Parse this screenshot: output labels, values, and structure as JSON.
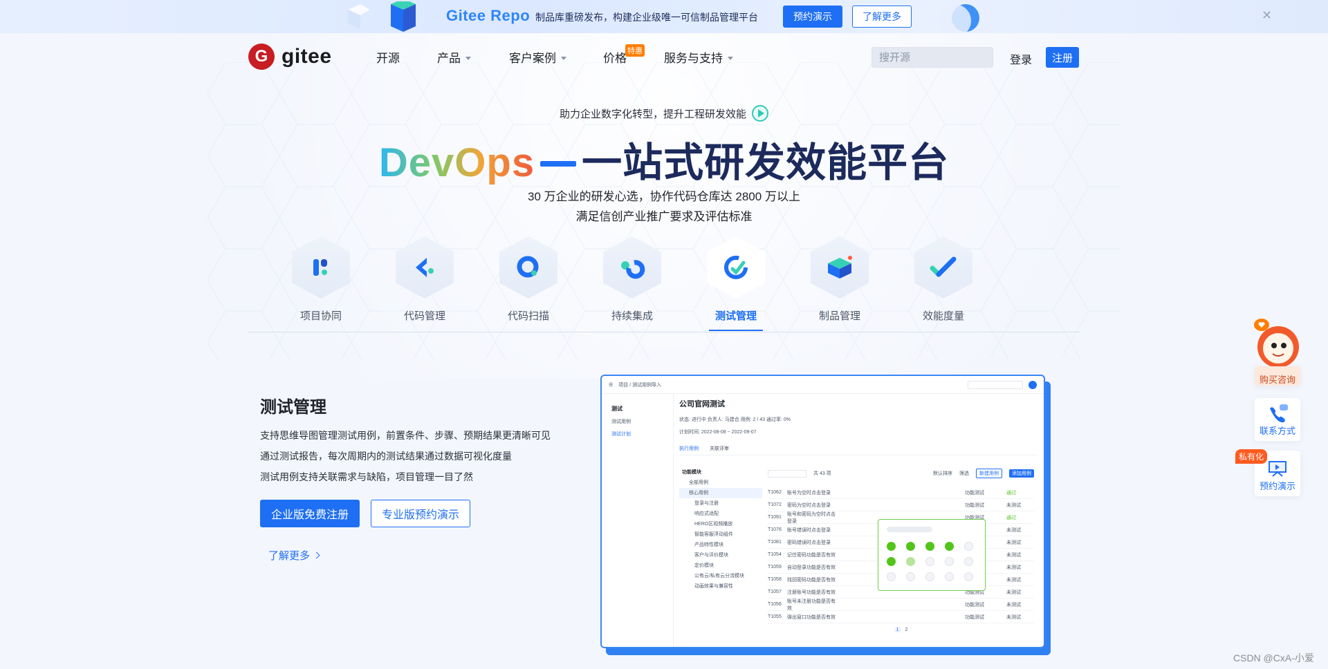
{
  "banner": {
    "brand": "Gitee Repo",
    "description": "制品库重磅发布，构建企业级唯一可信制品管理平台",
    "primary_button": "预约演示",
    "secondary_button": "了解更多",
    "close_icon": "close-icon"
  },
  "nav": {
    "logo_text": "gitee",
    "logo_mark": "G",
    "items": [
      {
        "label": "开源",
        "has_dropdown": false
      },
      {
        "label": "产品",
        "has_dropdown": true
      },
      {
        "label": "客户案例",
        "has_dropdown": true
      },
      {
        "label": "价格",
        "has_dropdown": false,
        "badge": "特惠"
      },
      {
        "label": "服务与支持",
        "has_dropdown": true
      }
    ],
    "search_placeholder": "搜开源",
    "login": "登录",
    "register": "注册"
  },
  "hero": {
    "tagline": "助力企业数字化转型，提升工程研发效能",
    "title_gradient": "DevOps",
    "title_rest": "一站式研发效能平台",
    "subtitle_1": "30 万企业的研发心选，协作代码仓库达 2800 万以上",
    "subtitle_2": "满足信创产业推广要求及评估标准"
  },
  "products": {
    "active_index": 4,
    "items": [
      {
        "label": "项目协同",
        "icon": "project-icon"
      },
      {
        "label": "代码管理",
        "icon": "code-icon"
      },
      {
        "label": "代码扫描",
        "icon": "scan-icon"
      },
      {
        "label": "持续集成",
        "icon": "ci-icon"
      },
      {
        "label": "测试管理",
        "icon": "test-icon"
      },
      {
        "label": "制品管理",
        "icon": "artifact-icon"
      },
      {
        "label": "效能度量",
        "icon": "metrics-icon"
      }
    ]
  },
  "section": {
    "title": "测试管理",
    "features": [
      "支持思维导图管理测试用例，前置条件、步骤、预期结果更清晰可见",
      "通过测试报告，每次周期内的测试结果通过数据可视化度量",
      "测试用例支持关联需求与缺陷，项目管理一目了然"
    ],
    "btn_free": "企业版免费注册",
    "btn_demo": "专业版预约演示",
    "learn_more": "了解更多"
  },
  "screenshot": {
    "breadcrumb": "项目 / 测试用例导入",
    "side_title": "测试",
    "side_items": [
      "测试用例",
      "测试计划"
    ],
    "plan_title": "公司官网测试",
    "meta": "状态: 进行中   负责人: 马建合   用例: 2 / 43   通过率: 0%",
    "dates": "计划时间:   2022-08-08  ~  2022-09-07",
    "tabs": [
      "执行用例",
      "关联评审"
    ],
    "tree_title": "功能模块",
    "tree_items": [
      "全部用例",
      "核心用例",
      "登录与注册",
      "响应式适配",
      "HERO区视频播放",
      "智能客服浮动组件",
      "产品特性模块",
      "客户与评价模块",
      "定价模块",
      "公有云/私有云分流模块",
      "动画效果与兼容性"
    ],
    "table_rows": [
      {
        "id": "T1062",
        "name": "账号为空时点击登录",
        "type": "功能测试",
        "result": "通过"
      },
      {
        "id": "T1072",
        "name": "密码为空时点击登录",
        "type": "功能测试",
        "result": "未测试"
      },
      {
        "id": "T1091",
        "name": "账号和密码为空时点击登录",
        "type": "功能测试",
        "result": "通过"
      },
      {
        "id": "T1076",
        "name": "账号错误时点击登录",
        "type": "功能测试",
        "result": "未测试"
      },
      {
        "id": "T1081",
        "name": "密码错误时点击登录",
        "type": "功能测试",
        "result": "未测试"
      },
      {
        "id": "T1054",
        "name": "记住密码功能是否有效",
        "type": "功能测试",
        "result": "未测试"
      },
      {
        "id": "T1059",
        "name": "自动登录功能是否有效",
        "type": "功能测试",
        "result": "未测试"
      },
      {
        "id": "T1058",
        "name": "找回密码功能是否有效",
        "type": "功能测试",
        "result": "未测试"
      },
      {
        "id": "T1057",
        "name": "注册账号功能是否有效",
        "type": "功能测试",
        "result": "未测试"
      },
      {
        "id": "T1056",
        "name": "账号未注册功能是否有效",
        "type": "功能测试",
        "result": "未测试"
      },
      {
        "id": "T1055",
        "name": "弹出窗口功能是否有效",
        "type": "功能测试",
        "result": "未测试"
      }
    ],
    "count_label": "共 43 项",
    "sort_label": "默认排序",
    "filter_label": "筛选",
    "new_case": "新建用例",
    "add_case": "添加用例",
    "pages": [
      "1",
      "2"
    ]
  },
  "floating": {
    "buy": "购买咨询",
    "contact": "联系方式",
    "private_badge": "私有化",
    "demo": "预约演示"
  },
  "watermark": "CSDN @CxA-小爱",
  "colors": {
    "primary": "#1e6ff3",
    "brand_red": "#c71d23",
    "pass_green": "#52c41a",
    "hot_orange": "#ff7d00"
  }
}
